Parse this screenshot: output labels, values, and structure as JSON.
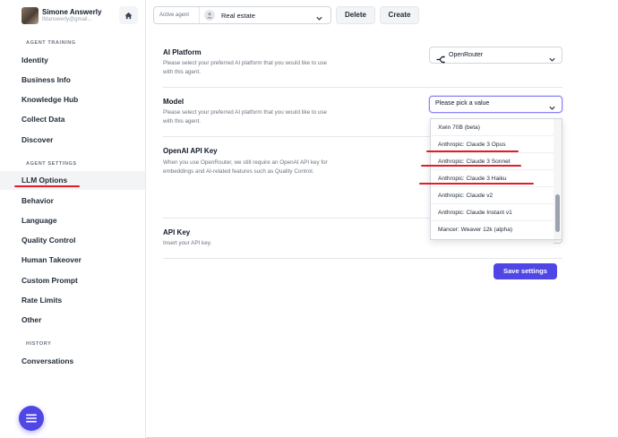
{
  "profile": {
    "name": "Simone Answerly",
    "email": "lfdanswerly@gmail..."
  },
  "sidebar": {
    "sections": [
      {
        "title": "Agent Training",
        "items": [
          "Identity",
          "Business Info",
          "Knowledge Hub",
          "Collect Data",
          "Discover"
        ]
      },
      {
        "title": "Agent Settings",
        "items": [
          "LLM Options",
          "Behavior",
          "Language",
          "Quality Control",
          "Human Takeover",
          "Custom Prompt",
          "Rate Limits",
          "Other"
        ]
      },
      {
        "title": "History",
        "items": [
          "Conversations"
        ]
      }
    ],
    "active_item": "LLM Options"
  },
  "topbar": {
    "agent_label": "Active agent",
    "agent_value": "Real estate",
    "delete_label": "Delete",
    "create_label": "Create"
  },
  "settings": {
    "ai_platform": {
      "title": "AI Platform",
      "desc": "Please select your preferred AI platform that you would like to use with this agent.",
      "value": "OpenRouter"
    },
    "model": {
      "title": "Model",
      "desc": "Please select your preferred AI platform that you would like to use with this agent.",
      "placeholder": "Please pick a value",
      "options": [
        "Xwin 70B (beta)",
        "Anthropic: Claude 3 Opus",
        "Anthropic: Claude 3 Sonnet",
        "Anthropic: Claude 3 Haiku",
        "Anthropic: Claude v2",
        "Anthropic: Claude Instant v1",
        "Mancer: Weaver 12k (alpha)"
      ]
    },
    "openai_key": {
      "title": "OpenAI API Key",
      "desc": "When you use OpenRouter, we still require an OpenAI API key for embeddings and AI-related features such as Quality Control."
    },
    "api_key": {
      "title": "API Key",
      "desc": "Insert your API key."
    },
    "save_label": "Save settings"
  },
  "colors": {
    "accent": "#5046e5",
    "annotation": "#e11d2a"
  }
}
